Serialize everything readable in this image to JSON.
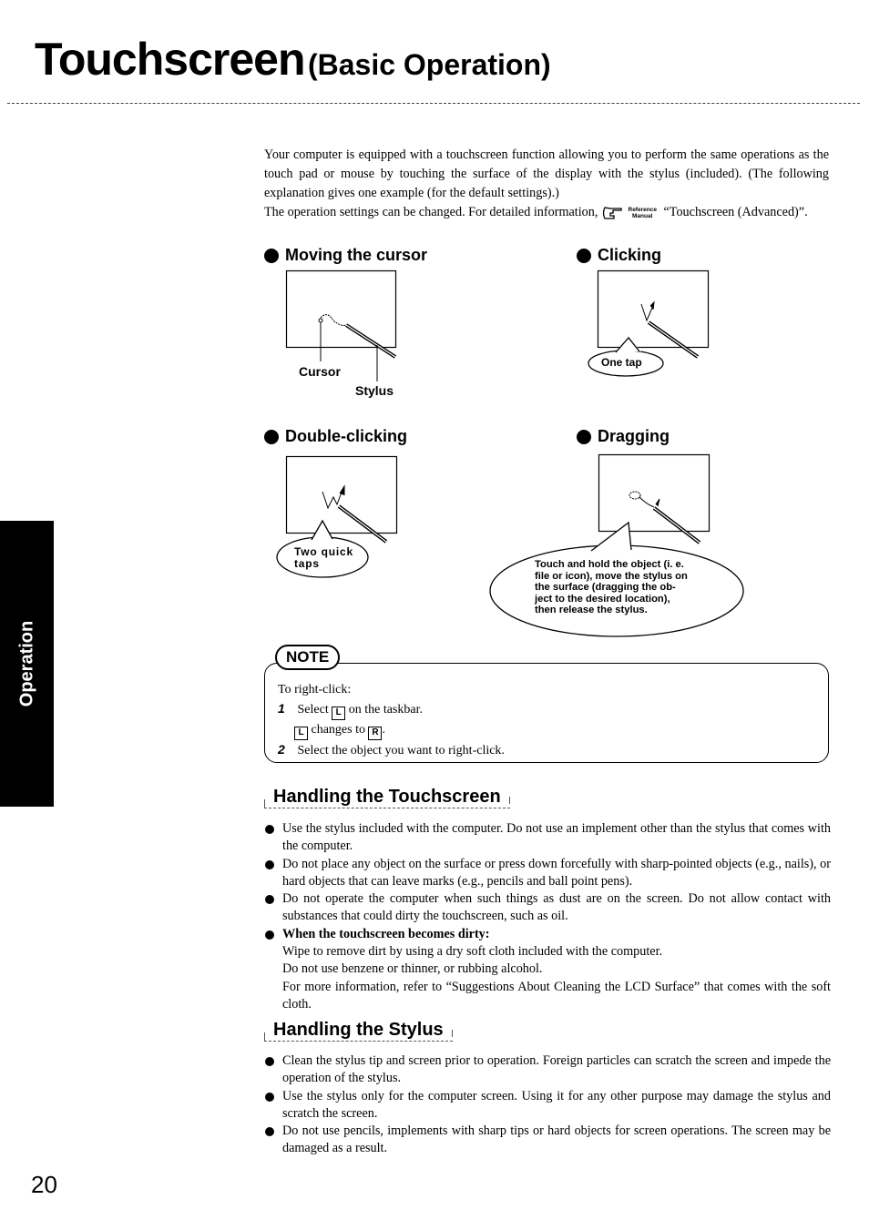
{
  "title": {
    "main": "Touchscreen",
    "sub": "(Basic Operation)"
  },
  "intro": {
    "paragraph1": "Your computer is equipped with a touchscreen function allowing you to perform the same operations as the touch pad or mouse by touching the surface of the display with the stylus (included). (The following explanation gives one example (for the default settings).)",
    "paragraph2_before": "The operation settings can be changed. For detailed information,",
    "reference_label_top": "Reference",
    "reference_label_bottom": "Manual",
    "paragraph2_after": "“Touchscreen (Advanced)”.",
    "reference_icon": "pointing-hand-icon"
  },
  "operations": {
    "moving": {
      "heading": "Moving the cursor",
      "label_cursor": "Cursor",
      "label_stylus": "Stylus"
    },
    "clicking": {
      "heading": "Clicking",
      "bubble": "One tap"
    },
    "double": {
      "heading": "Double-clicking",
      "bubble_line1": "Two quick",
      "bubble_line2": "taps"
    },
    "dragging": {
      "heading": "Dragging",
      "bubble_lines": [
        "Touch and hold the object (i. e.",
        "file or icon), move the stylus on",
        "the surface (dragging the ob-",
        "ject to the desired location),",
        "then release the stylus."
      ]
    }
  },
  "note": {
    "tag": "NOTE",
    "intro": "To right-click:",
    "step1_num": "1",
    "step1_before": "Select",
    "step1_key": "L",
    "step1_after": "on the taskbar.",
    "step1b_key_from": "L",
    "step1b_middle": "changes to",
    "step1b_key_to": "R",
    "step1b_end": ".",
    "step2_num": "2",
    "step2_text": "Select the object you want to right-click."
  },
  "handling_touchscreen": {
    "heading": "Handling the Touchscreen",
    "bullets": [
      "Use the stylus included with the computer.  Do not use an implement other than the stylus that comes with the computer.",
      "Do not place any object on the surface or press down forcefully with sharp-pointed objects (e.g., nails), or hard objects that can leave marks (e.g., pencils and ball point pens).",
      "Do not operate the computer when such things as dust are on the screen.  Do not allow contact with substances that could dirty the touchscreen, such as oil."
    ],
    "dirty": {
      "heading": "When the touchscreen becomes dirty:",
      "lines": [
        "Wipe to remove dirt by using a dry soft cloth included with the computer.",
        "Do not use benzene or thinner, or rubbing alcohol.",
        "For more information, refer to “Suggestions About Cleaning the LCD Surface” that comes with the soft cloth."
      ]
    }
  },
  "handling_stylus": {
    "heading": "Handling the Stylus",
    "bullets": [
      "Clean the stylus tip and screen prior to operation.  Foreign particles can scratch the screen and impede the operation of the stylus.",
      "Use the stylus only for the computer screen.  Using it for any other purpose may damage the stylus and scratch the screen.",
      "Do not use pencils, implements with sharp tips or hard objects for screen operations.  The screen may be damaged as a result."
    ]
  },
  "side_tab": "Operation",
  "page_number": "20"
}
